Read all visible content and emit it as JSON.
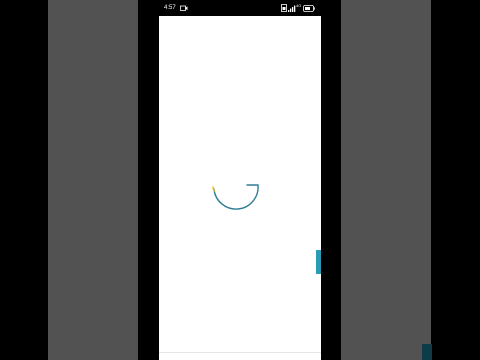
{
  "status_bar": {
    "time": "4:57",
    "network_label": "4G",
    "icons": [
      "camera-icon",
      "sim-icon",
      "signal-icon",
      "battery-icon"
    ]
  },
  "loading": {
    "spinner_colors": {
      "arc": "#2f7e94",
      "accent": "#f2c21c"
    }
  },
  "colors": {
    "backdrop": "#000000",
    "side_panels": "#525252",
    "screen": "#ffffff",
    "edge_handle": "#2a9bb3",
    "corner_tab": "#0d3b47"
  }
}
